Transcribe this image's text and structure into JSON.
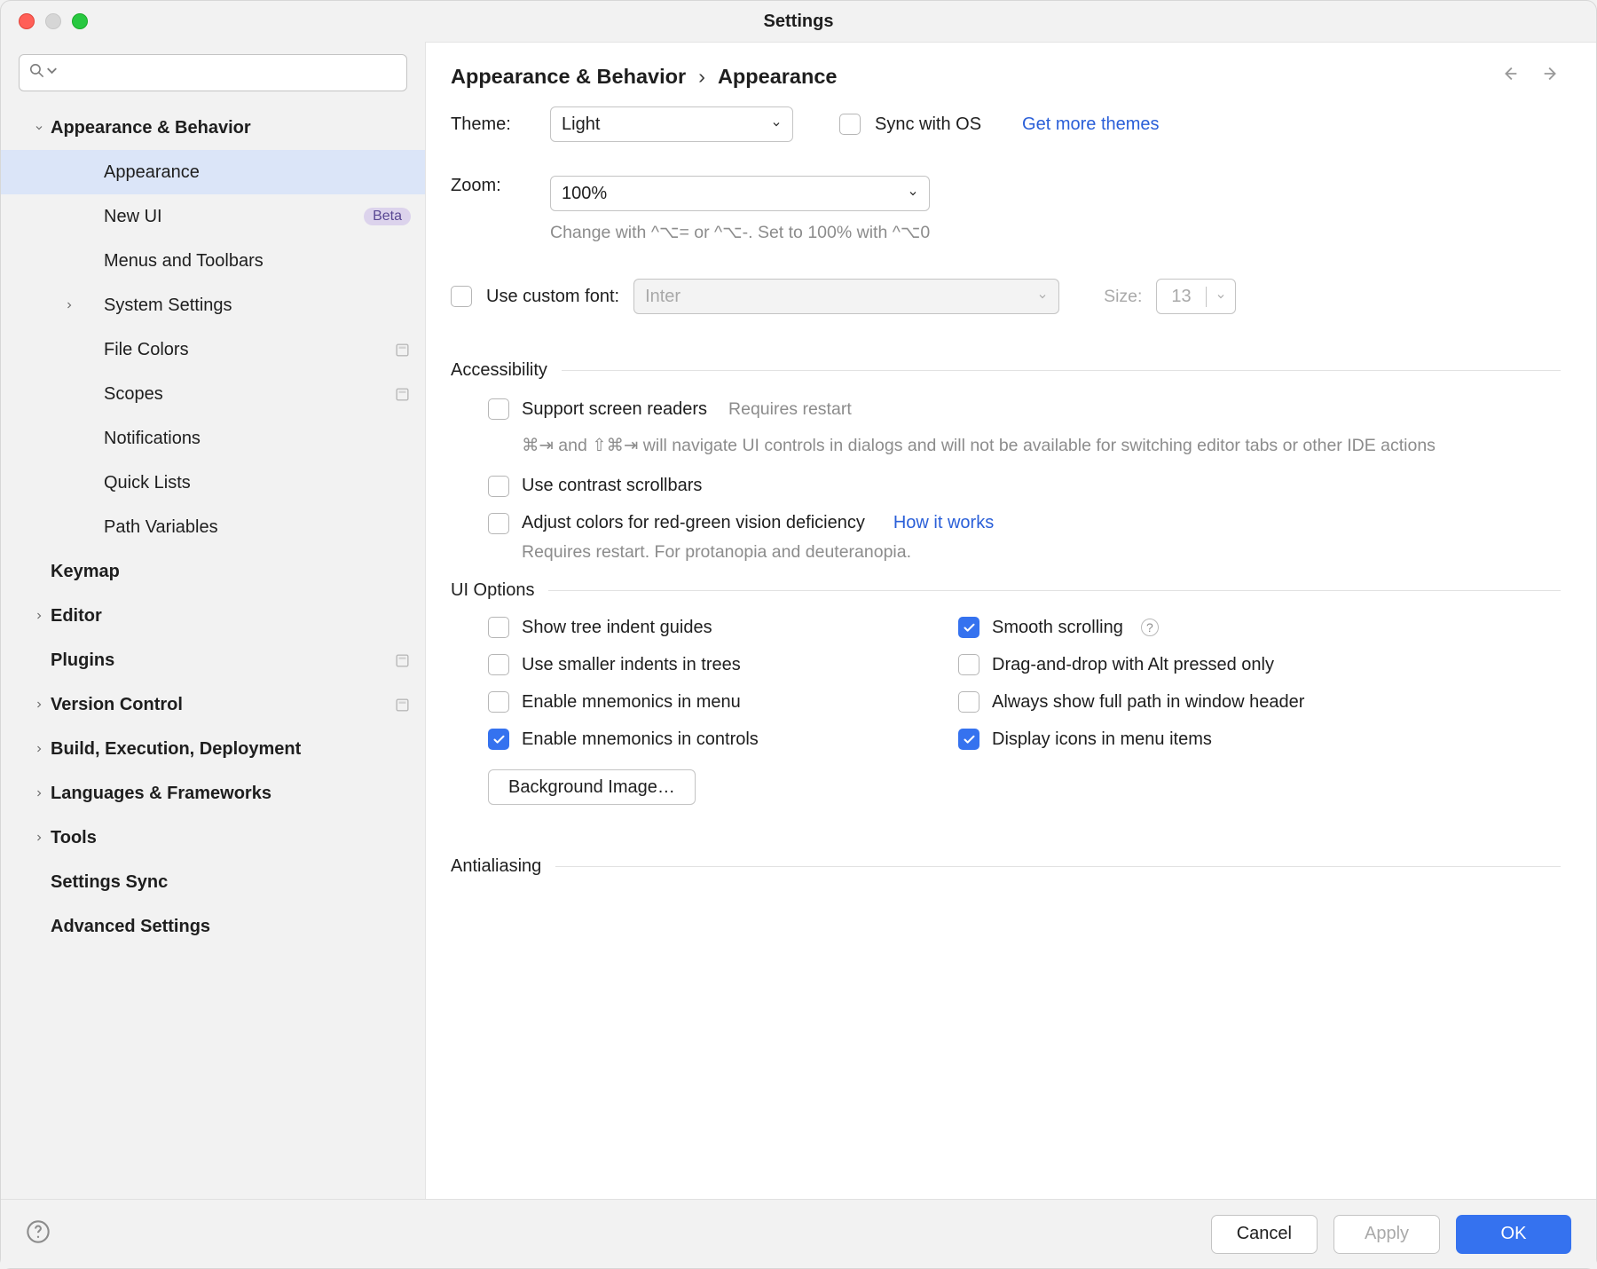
{
  "window": {
    "title": "Settings"
  },
  "search": {
    "placeholder": ""
  },
  "sidebar": {
    "items": [
      {
        "label": "Appearance & Behavior",
        "bold": true,
        "depth": 1,
        "expander": "down",
        "selected": false
      },
      {
        "label": "Appearance",
        "bold": false,
        "depth": 2,
        "expander": "",
        "selected": true
      },
      {
        "label": "New UI",
        "bold": false,
        "depth": 2,
        "expander": "",
        "badge": "Beta"
      },
      {
        "label": "Menus and Toolbars",
        "bold": false,
        "depth": 2,
        "expander": ""
      },
      {
        "label": "System Settings",
        "bold": false,
        "depth": 2,
        "expander": "right"
      },
      {
        "label": "File Colors",
        "bold": false,
        "depth": 2,
        "expander": "",
        "tag": true
      },
      {
        "label": "Scopes",
        "bold": false,
        "depth": 2,
        "expander": "",
        "tag": true
      },
      {
        "label": "Notifications",
        "bold": false,
        "depth": 2,
        "expander": ""
      },
      {
        "label": "Quick Lists",
        "bold": false,
        "depth": 2,
        "expander": ""
      },
      {
        "label": "Path Variables",
        "bold": false,
        "depth": 2,
        "expander": ""
      },
      {
        "label": "Keymap",
        "bold": true,
        "depth": 1,
        "expander": ""
      },
      {
        "label": "Editor",
        "bold": true,
        "depth": 1,
        "expander": "right"
      },
      {
        "label": "Plugins",
        "bold": true,
        "depth": 1,
        "expander": "",
        "tag": true
      },
      {
        "label": "Version Control",
        "bold": true,
        "depth": 1,
        "expander": "right",
        "tag": true
      },
      {
        "label": "Build, Execution, Deployment",
        "bold": true,
        "depth": 1,
        "expander": "right"
      },
      {
        "label": "Languages & Frameworks",
        "bold": true,
        "depth": 1,
        "expander": "right"
      },
      {
        "label": "Tools",
        "bold": true,
        "depth": 1,
        "expander": "right"
      },
      {
        "label": "Settings Sync",
        "bold": true,
        "depth": 1,
        "expander": ""
      },
      {
        "label": "Advanced Settings",
        "bold": true,
        "depth": 1,
        "expander": ""
      }
    ]
  },
  "breadcrumb": {
    "parent": "Appearance & Behavior",
    "child": "Appearance"
  },
  "theme": {
    "label": "Theme:",
    "value": "Light",
    "sync_label": "Sync with OS",
    "get_more_link": "Get more themes"
  },
  "zoom": {
    "label": "Zoom:",
    "value": "100%",
    "hint": "Change with ^⌥= or ^⌥-. Set to 100% with ^⌥0"
  },
  "font": {
    "label": "Use custom font:",
    "value": "Inter",
    "size_label": "Size:",
    "size_value": "13"
  },
  "sections": {
    "accessibility": {
      "title": "Accessibility"
    },
    "ui_options": {
      "title": "UI Options"
    },
    "antialiasing": {
      "title": "Antialiasing"
    }
  },
  "access": {
    "screen_readers_label": "Support screen readers",
    "screen_readers_req": "Requires restart",
    "screen_readers_hint": "⌘⇥ and ⇧⌘⇥ will navigate UI controls in dialogs and will not be available for switching editor tabs or other IDE actions",
    "contrast_label": "Use contrast scrollbars",
    "color_def_label": "Adjust colors for red-green vision deficiency",
    "color_def_link": "How it works",
    "color_def_hint": "Requires restart. For protanopia and deuteranopia."
  },
  "uiopts": {
    "tree_indent": "Show tree indent guides",
    "smaller_indents": "Use smaller indents in trees",
    "mnemonics_menu": "Enable mnemonics in menu",
    "mnemonics_ctrl": "Enable mnemonics in controls",
    "smooth_scroll": "Smooth scrolling",
    "dnd_alt": "Drag-and-drop with Alt pressed only",
    "full_path": "Always show full path in window header",
    "menu_icons": "Display icons in menu items",
    "bg_image_btn": "Background Image…"
  },
  "footer": {
    "cancel": "Cancel",
    "apply": "Apply",
    "ok": "OK"
  }
}
